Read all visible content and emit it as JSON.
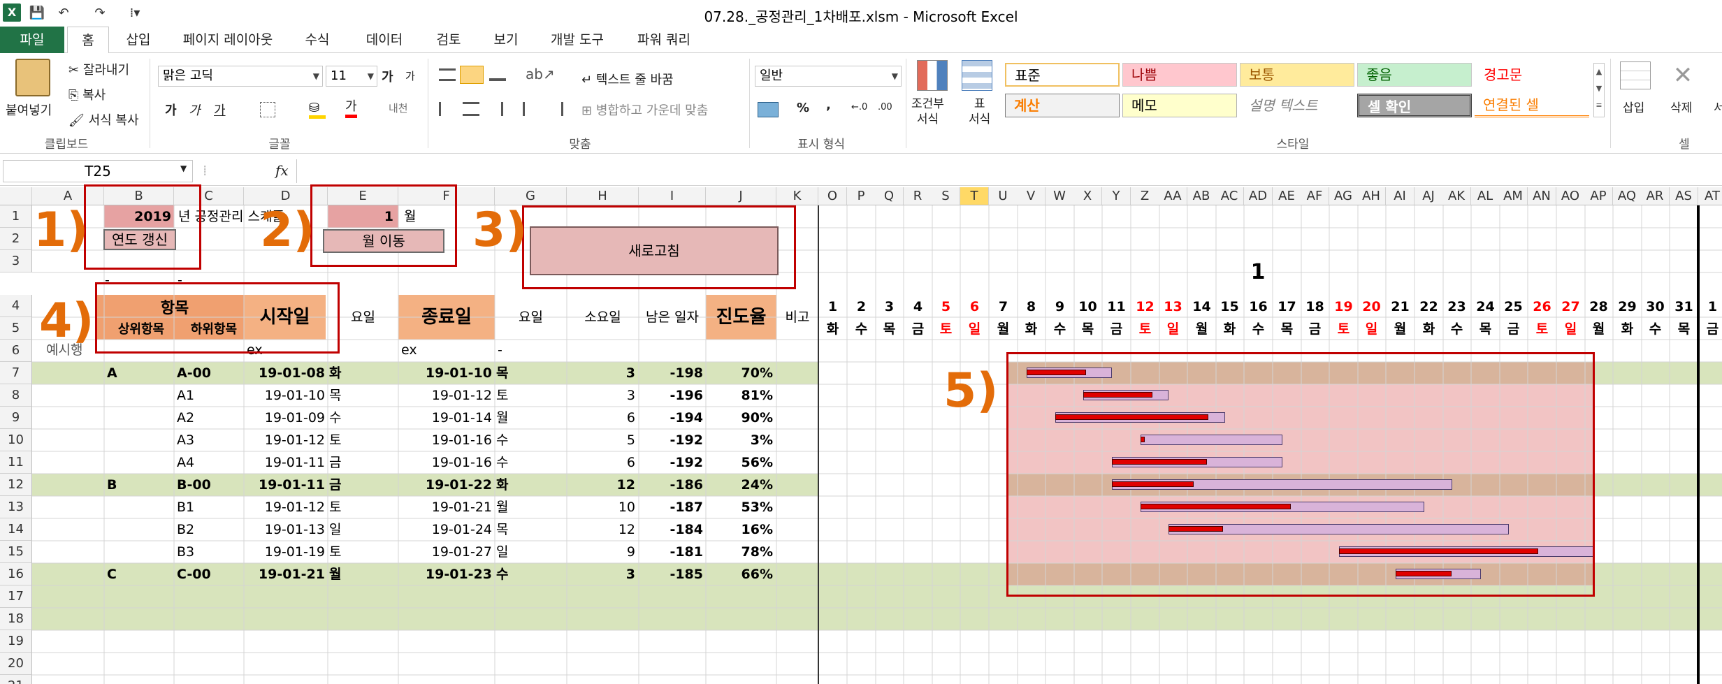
{
  "window": {
    "title": "07.28._공정관리_1차배포.xlsm  -  Microsoft Excel",
    "logo": "X"
  },
  "qat": {
    "save": "💾",
    "undo": "↶",
    "redo": "↷",
    "more": "⁞▾"
  },
  "tabs": [
    "파일",
    "홈",
    "삽입",
    "페이지 레이아웃",
    "수식",
    "데이터",
    "검토",
    "보기",
    "개발 도구",
    "파워 쿼리"
  ],
  "ribbon": {
    "clipboard": {
      "paste": "붙여넣기",
      "cut": "잘라내기",
      "copy": "복사",
      "format_painter": "서식 복사",
      "label": "클립보드"
    },
    "font": {
      "name": "맑은 고딕",
      "size": "11",
      "grow": "가",
      "shrink": "가",
      "bold": "가",
      "italic": "가",
      "underline": "가",
      "phonetic": "내천",
      "label": "글꼴"
    },
    "align": {
      "wrap": "텍스트 줄 바꿈",
      "merge": "병합하고 가운데 맞춤",
      "label": "맞춤"
    },
    "number": {
      "format": "일반",
      "percent": "%",
      "comma": ",",
      "inc": "←.0\n.00",
      "dec": ".00\n→.0",
      "label": "표시 형식"
    },
    "styles": {
      "cond": "조건부\n서식",
      "table": "표\n서식",
      "cells": [
        [
          "표준",
          "나쁨",
          "보통",
          "좋음",
          "경고문"
        ],
        [
          "계산",
          "메모",
          "설명 텍스트",
          "셀 확인",
          "연결된 셀"
        ]
      ],
      "label": "스타일"
    },
    "cells": {
      "insert": "삽입",
      "delete": "삭제",
      "format": "서",
      "label": "셀"
    }
  },
  "formula": {
    "namebox": "T25",
    "fx": "fx",
    "value": ""
  },
  "colors": {
    "accent": "#217346",
    "header_orange": "#f4b183",
    "header_salmon": "#f08080",
    "green_row": "#d8e4bc",
    "gantt_pink": "#f2c4c4",
    "gantt_tan": "#d8b49c",
    "annot": "#e36c09",
    "box": "#c00000",
    "bar_red": "#e00000",
    "bar_purple": "#d9b3d9"
  },
  "columns": [
    "A",
    "B",
    "C",
    "D",
    "E",
    "F",
    "G",
    "H",
    "I",
    "J",
    "K",
    "O",
    "P",
    "Q",
    "R",
    "S",
    "T",
    "U",
    "V",
    "W",
    "X",
    "Y",
    "Z",
    "AA",
    "AB",
    "AC",
    "AD",
    "AE",
    "AF",
    "AG",
    "AH",
    "AI",
    "AJ",
    "AK",
    "AL",
    "AM",
    "AN",
    "AO",
    "AP",
    "AQ",
    "AR",
    "AS",
    "AT"
  ],
  "rows": [
    "1",
    "2",
    "3",
    "4",
    "5",
    "6",
    "7",
    "8",
    "9",
    "10",
    "11",
    "12",
    "13",
    "14",
    "15",
    "16",
    "17",
    "18",
    "19",
    "20",
    "21"
  ],
  "sheet": {
    "year": "2019",
    "year_suffix": "년 공정관리 스케줄",
    "year_btn": "연도 갱신",
    "month": "1",
    "month_suffix": "월",
    "month_btn": "월 이동",
    "refresh_btn": "새로고침",
    "month_title": "1",
    "hdr_item": "항목",
    "hdr_parent": "상위항목",
    "hdr_child": "하위항목",
    "hdr_start": "시작일",
    "hdr_dow1": "요일",
    "hdr_end": "종료일",
    "hdr_dow2": "요일",
    "hdr_dur": "소요일",
    "hdr_remain": "남은 일자",
    "hdr_prog": "진도율",
    "hdr_note": "비고",
    "example": "예시행",
    "ex1": "ex",
    "ex2": "ex",
    "dash1": "-",
    "dash2": "-",
    "dash3": "-"
  },
  "days": [
    "1",
    "2",
    "3",
    "4",
    "5",
    "6",
    "7",
    "8",
    "9",
    "10",
    "11",
    "12",
    "13",
    "14",
    "15",
    "16",
    "17",
    "18",
    "19",
    "20",
    "21",
    "22",
    "23",
    "24",
    "25",
    "26",
    "27",
    "28",
    "29",
    "30",
    "31",
    "1"
  ],
  "dows": [
    "화",
    "수",
    "목",
    "금",
    "토",
    "일",
    "월",
    "화",
    "수",
    "목",
    "금",
    "토",
    "일",
    "월",
    "화",
    "수",
    "목",
    "금",
    "토",
    "일",
    "월",
    "화",
    "수",
    "목",
    "금",
    "토",
    "일",
    "월",
    "화",
    "수",
    "목",
    "금"
  ],
  "tasks": [
    {
      "p": "A",
      "c": "A-00",
      "s": "19-01-08",
      "sd": "화",
      "e": "19-01-10",
      "ed": "목",
      "dur": "3",
      "rem": "-198",
      "prog": "70%",
      "bold": true
    },
    {
      "p": "",
      "c": "A1",
      "s": "19-01-10",
      "sd": "목",
      "e": "19-01-12",
      "ed": "토",
      "dur": "3",
      "rem": "-196",
      "prog": "81%",
      "bold": false
    },
    {
      "p": "",
      "c": "A2",
      "s": "19-01-09",
      "sd": "수",
      "e": "19-01-14",
      "ed": "월",
      "dur": "6",
      "rem": "-194",
      "prog": "90%",
      "bold": false
    },
    {
      "p": "",
      "c": "A3",
      "s": "19-01-12",
      "sd": "토",
      "e": "19-01-16",
      "ed": "수",
      "dur": "5",
      "rem": "-192",
      "prog": "3%",
      "bold": false
    },
    {
      "p": "",
      "c": "A4",
      "s": "19-01-11",
      "sd": "금",
      "e": "19-01-16",
      "ed": "수",
      "dur": "6",
      "rem": "-192",
      "prog": "56%",
      "bold": false
    },
    {
      "p": "B",
      "c": "B-00",
      "s": "19-01-11",
      "sd": "금",
      "e": "19-01-22",
      "ed": "화",
      "dur": "12",
      "rem": "-186",
      "prog": "24%",
      "bold": true
    },
    {
      "p": "",
      "c": "B1",
      "s": "19-01-12",
      "sd": "토",
      "e": "19-01-21",
      "ed": "월",
      "dur": "10",
      "rem": "-187",
      "prog": "53%",
      "bold": false
    },
    {
      "p": "",
      "c": "B2",
      "s": "19-01-13",
      "sd": "일",
      "e": "19-01-24",
      "ed": "목",
      "dur": "12",
      "rem": "-184",
      "prog": "16%",
      "bold": false
    },
    {
      "p": "",
      "c": "B3",
      "s": "19-01-19",
      "sd": "토",
      "e": "19-01-27",
      "ed": "일",
      "dur": "9",
      "rem": "-181",
      "prog": "78%",
      "bold": false
    },
    {
      "p": "C",
      "c": "C-00",
      "s": "19-01-21",
      "sd": "월",
      "e": "19-01-23",
      "ed": "수",
      "dur": "3",
      "rem": "-185",
      "prog": "66%",
      "bold": true
    }
  ],
  "annotations": [
    "1)",
    "2)",
    "3)",
    "4)",
    "5)"
  ]
}
